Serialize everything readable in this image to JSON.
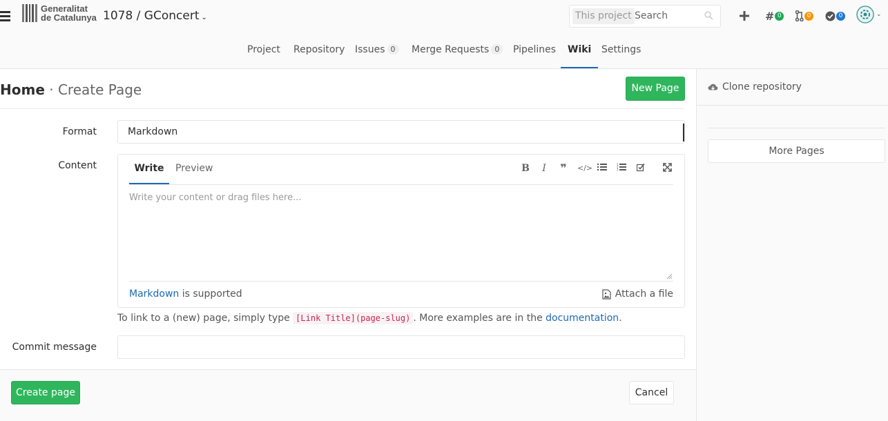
{
  "header": {
    "logo_line1": "Generalitat",
    "logo_line2": "de Catalunya",
    "project_title": "1078 / GConcert",
    "search_scope": "This project",
    "search_placeholder": "Search",
    "issues_count": "0",
    "mr_count": "0",
    "todo_count": "0",
    "icons": [
      "hamburger-icon",
      "chevron-down-icon",
      "search-icon",
      "plus-icon",
      "hash-icon",
      "merge-request-icon",
      "todo-check-icon",
      "user-avatar"
    ]
  },
  "nav": {
    "project": "Project",
    "repository": "Repository",
    "issues": "Issues",
    "issues_count": "0",
    "merge_requests": "Merge Requests",
    "mr_count": "0",
    "pipelines": "Pipelines",
    "wiki": "Wiki",
    "settings": "Settings"
  },
  "page": {
    "title_main": "Home",
    "title_sep": " · ",
    "title_sub": "Create Page",
    "new_page_button": "New Page"
  },
  "form": {
    "format_label": "Format",
    "format_value": "Markdown",
    "content_label": "Content",
    "tab_write": "Write",
    "tab_preview": "Preview",
    "content_placeholder": "Write your content or drag files here...",
    "markdown_link": "Markdown",
    "markdown_supported": " is supported",
    "attach_file": "Attach a file",
    "hint_prefix": "To link to a (new) page, simply type ",
    "hint_code": "[Link Title](page-slug)",
    "hint_middle": ". More examples are in the ",
    "hint_link": "documentation",
    "hint_suffix": ".",
    "commit_label": "Commit message",
    "commit_value": "",
    "create_button": "Create page",
    "cancel_button": "Cancel"
  },
  "sidebar": {
    "clone_repository": "Clone repository",
    "more_pages": "More Pages"
  },
  "colors": {
    "green": "#2fb65d",
    "blue": "#1b69b6",
    "issues_badge": "#1aaa55",
    "mr_badge": "#fc9403",
    "todo_badge": "#1f78d1"
  }
}
